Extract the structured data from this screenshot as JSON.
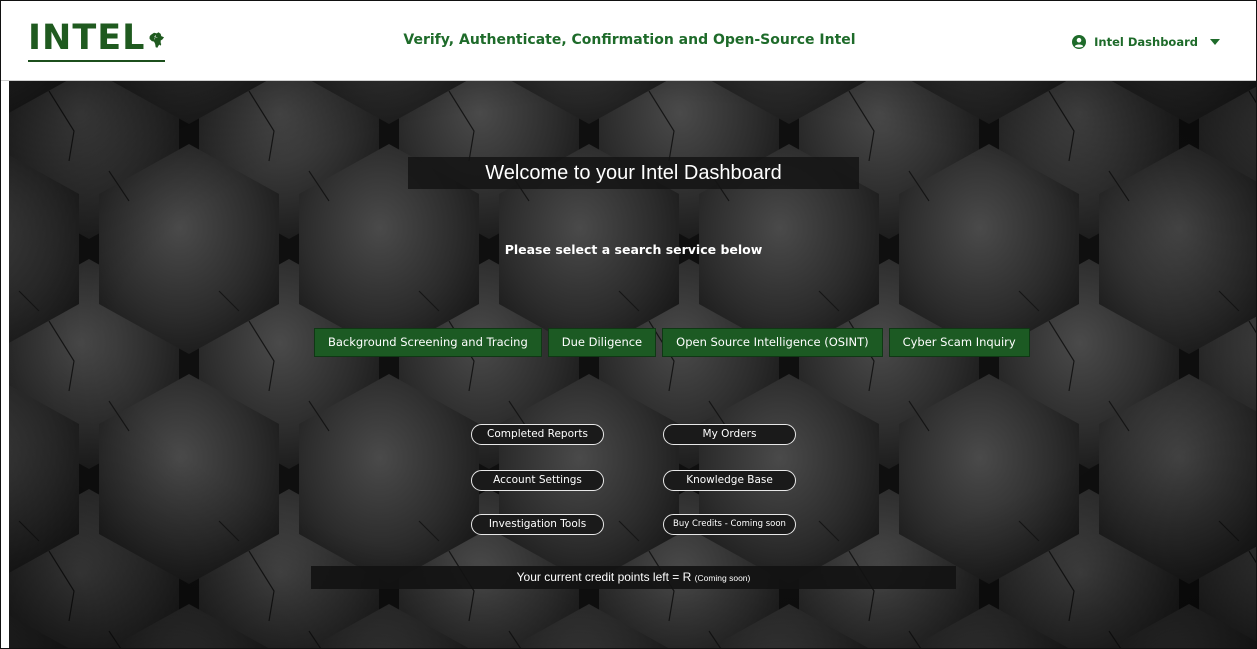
{
  "header": {
    "logo_text": "INTEL",
    "title": "Verify, Authenticate, Confirmation and Open-Source Intel",
    "user_menu_label": "Intel Dashboard",
    "icons": {
      "logo": "africa-map-icon",
      "user": "user-icon",
      "menu": "chevron-down-icon"
    }
  },
  "main": {
    "welcome": "Welcome to your Intel Dashboard",
    "subtitle": "Please select a search service below",
    "services": [
      "Background Screening and Tracing",
      "Due Diligence",
      "Open Source Intelligence (OSINT)",
      "Cyber Scam Inquiry"
    ],
    "links": [
      "Completed Reports",
      "My Orders",
      "Account Settings",
      "Knowledge Base",
      "Investigation Tools",
      "Buy Credits - Coming soon"
    ],
    "credit_text": "Your current credit points left = R",
    "credit_note": "(Coming soon)"
  },
  "colors": {
    "brand_green": "#1e6b2a",
    "button_green": "#1c5a23",
    "background": "#2a2a2a"
  }
}
